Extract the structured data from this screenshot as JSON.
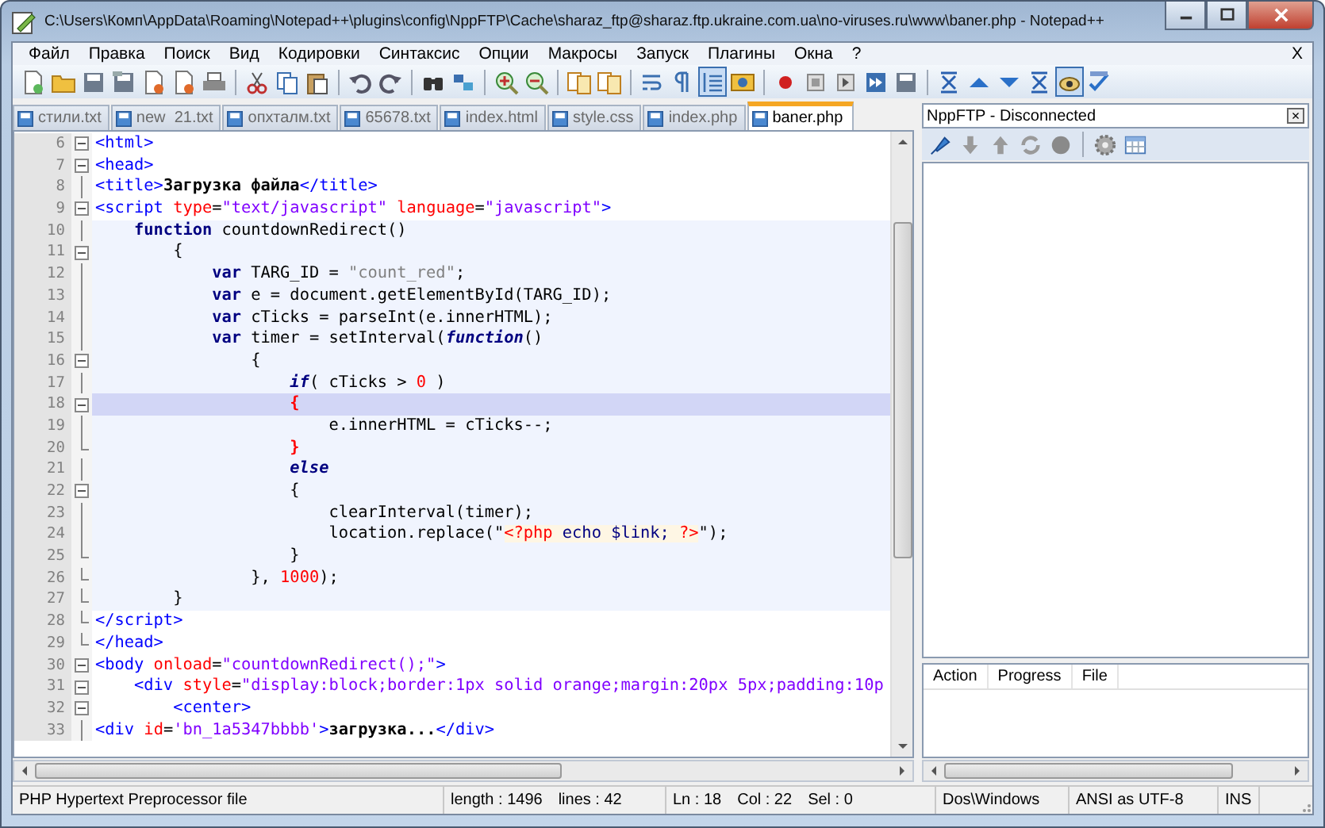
{
  "window": {
    "title": "C:\\Users\\Комп\\AppData\\Roaming\\Notepad++\\plugins\\config\\NppFTP\\Cache\\sharaz_ftp@sharaz.ftp.ukraine.com.ua\\no-viruses.ru\\www\\baner.php - Notepad++"
  },
  "menu": [
    "Файл",
    "Правка",
    "Поиск",
    "Вид",
    "Кодировки",
    "Синтаксис",
    "Опции",
    "Макросы",
    "Запуск",
    "Плагины",
    "Окна",
    "?"
  ],
  "menu_close": "X",
  "toolbar": [
    {
      "pressed": false
    },
    {
      "pressed": false
    },
    {
      "pressed": false
    },
    {
      "pressed": false
    },
    {
      "pressed": false
    },
    {
      "pressed": false
    },
    {
      "pressed": false
    },
    {
      "pressed": false
    },
    {
      "pressed": false
    },
    {
      "pressed": false
    },
    {
      "pressed": false
    },
    {
      "pressed": false
    },
    {
      "pressed": false
    },
    {
      "pressed": false
    },
    {
      "pressed": false
    },
    {
      "pressed": false
    },
    {
      "pressed": false
    },
    {
      "pressed": false
    },
    {
      "pressed": false
    },
    {
      "pressed": false
    },
    {
      "pressed": true
    },
    {
      "pressed": false
    },
    {
      "pressed": false
    },
    {
      "pressed": false
    },
    {
      "pressed": false
    },
    {
      "pressed": false
    },
    {
      "pressed": false
    },
    {
      "pressed": false
    },
    {
      "pressed": false
    },
    {
      "pressed": false
    },
    {
      "pressed": false
    },
    {
      "pressed": true
    },
    {
      "pressed": false
    }
  ],
  "tabs": [
    {
      "label": "стили.txt",
      "selected": false
    },
    {
      "label": "new  21.txt",
      "selected": false
    },
    {
      "label": "опхталм.txt",
      "selected": false
    },
    {
      "label": "65678.txt",
      "selected": false
    },
    {
      "label": "index.html",
      "selected": false
    },
    {
      "label": "style.css",
      "selected": false
    },
    {
      "label": "index.php",
      "selected": false
    },
    {
      "label": "baner.php",
      "selected": true
    }
  ],
  "editor": {
    "lines": [
      {
        "number": "6",
        "kind": "fold-start",
        "block": false,
        "current": false,
        "tokens": [
          {
            "text": "<html>",
            "kind": "tag"
          }
        ]
      },
      {
        "number": "7",
        "kind": "fold-start",
        "block": false,
        "current": false,
        "tokens": [
          {
            "text": "<head>",
            "kind": "tag"
          }
        ]
      },
      {
        "number": "8",
        "kind": "fold-body",
        "block": false,
        "current": false,
        "tokens": [
          {
            "text": "<title>",
            "kind": "tag"
          },
          {
            "text": "Загрузка файла",
            "kind": "text"
          },
          {
            "text": "</title>",
            "kind": "tag"
          }
        ]
      },
      {
        "number": "9",
        "kind": "fold-start",
        "block": false,
        "current": false,
        "tokens": [
          {
            "text": "<script",
            "kind": "tag"
          },
          {
            "text": " type",
            "kind": "attr"
          },
          {
            "text": "=",
            "kind": "code"
          },
          {
            "text": "\"text/javascript\"",
            "kind": "val"
          },
          {
            "text": " language",
            "kind": "attr"
          },
          {
            "text": "=",
            "kind": "code"
          },
          {
            "text": "\"javascript\"",
            "kind": "val"
          },
          {
            "text": ">",
            "kind": "tag"
          }
        ]
      },
      {
        "number": "10",
        "kind": "fold-body",
        "block": true,
        "current": false,
        "tokens": [
          {
            "text": "    function",
            "kind": "kw"
          },
          {
            "text": " countdownRedirect()",
            "kind": "code"
          }
        ]
      },
      {
        "number": "11",
        "kind": "fold-start",
        "block": true,
        "current": false,
        "tokens": [
          {
            "text": "        {",
            "kind": "code"
          }
        ]
      },
      {
        "number": "12",
        "kind": "fold-body",
        "block": true,
        "current": false,
        "tokens": [
          {
            "text": "            var",
            "kind": "kw"
          },
          {
            "text": " TARG_ID = ",
            "kind": "code"
          },
          {
            "text": "\"count_red\"",
            "kind": "str"
          },
          {
            "text": ";",
            "kind": "code"
          }
        ]
      },
      {
        "number": "13",
        "kind": "fold-body",
        "block": true,
        "current": false,
        "tokens": [
          {
            "text": "            var",
            "kind": "kw"
          },
          {
            "text": " e = document.getElementById(TARG_ID);",
            "kind": "code"
          }
        ]
      },
      {
        "number": "14",
        "kind": "fold-body",
        "block": true,
        "current": false,
        "tokens": [
          {
            "text": "            var",
            "kind": "kw"
          },
          {
            "text": " cTicks = parseInt(e.innerHTML);",
            "kind": "code"
          }
        ]
      },
      {
        "number": "15",
        "kind": "fold-body",
        "block": true,
        "current": false,
        "tokens": [
          {
            "text": "            var",
            "kind": "kw"
          },
          {
            "text": " timer = setInterval(",
            "kind": "code"
          },
          {
            "text": "function",
            "kind": "kwi"
          },
          {
            "text": "()",
            "kind": "code"
          }
        ]
      },
      {
        "number": "16",
        "kind": "fold-start",
        "block": true,
        "current": false,
        "tokens": [
          {
            "text": "                {",
            "kind": "code"
          }
        ]
      },
      {
        "number": "17",
        "kind": "fold-body",
        "block": true,
        "current": false,
        "tokens": [
          {
            "text": "                    if",
            "kind": "kwi"
          },
          {
            "text": "( cTicks > ",
            "kind": "code"
          },
          {
            "text": "0",
            "kind": "num"
          },
          {
            "text": " )",
            "kind": "code"
          }
        ]
      },
      {
        "number": "18",
        "kind": "fold-start",
        "block": true,
        "current": true,
        "tokens": [
          {
            "text": "                    {",
            "kind": "brace"
          }
        ]
      },
      {
        "number": "19",
        "kind": "fold-body",
        "block": true,
        "current": false,
        "tokens": [
          {
            "text": "                        e.innerHTML = cTicks--;",
            "kind": "code"
          }
        ]
      },
      {
        "number": "20",
        "kind": "fold-end",
        "block": true,
        "current": false,
        "tokens": [
          {
            "text": "                    }",
            "kind": "brace"
          }
        ]
      },
      {
        "number": "21",
        "kind": "fold-body",
        "block": true,
        "current": false,
        "tokens": [
          {
            "text": "                    else",
            "kind": "kwi"
          }
        ]
      },
      {
        "number": "22",
        "kind": "fold-start",
        "block": true,
        "current": false,
        "tokens": [
          {
            "text": "                    {",
            "kind": "code"
          }
        ]
      },
      {
        "number": "23",
        "kind": "fold-body",
        "block": true,
        "current": false,
        "tokens": [
          {
            "text": "                        clearInterval(timer);",
            "kind": "code"
          }
        ]
      },
      {
        "number": "24",
        "kind": "fold-body",
        "block": true,
        "current": false,
        "tokens": [
          {
            "text": "                        location.replace(\"",
            "kind": "code"
          },
          {
            "text": "<?php",
            "kind": "phpd"
          },
          {
            "text": " echo $link; ",
            "kind": "php"
          },
          {
            "text": "?>",
            "kind": "phpd"
          },
          {
            "text": "\");",
            "kind": "code"
          }
        ]
      },
      {
        "number": "25",
        "kind": "fold-end",
        "block": true,
        "current": false,
        "tokens": [
          {
            "text": "                    }",
            "kind": "code"
          }
        ]
      },
      {
        "number": "26",
        "kind": "fold-end",
        "block": true,
        "current": false,
        "tokens": [
          {
            "text": "                }, ",
            "kind": "code"
          },
          {
            "text": "1000",
            "kind": "num"
          },
          {
            "text": ");",
            "kind": "code"
          }
        ]
      },
      {
        "number": "27",
        "kind": "fold-end",
        "block": true,
        "current": false,
        "tokens": [
          {
            "text": "        }",
            "kind": "code"
          }
        ]
      },
      {
        "number": "28",
        "kind": "fold-end",
        "block": false,
        "current": false,
        "tokens": [
          {
            "text": "</script>",
            "kind": "tag"
          }
        ]
      },
      {
        "number": "29",
        "kind": "fold-end",
        "block": false,
        "current": false,
        "tokens": [
          {
            "text": "</head>",
            "kind": "tag"
          }
        ]
      },
      {
        "number": "30",
        "kind": "fold-start",
        "block": false,
        "current": false,
        "tokens": [
          {
            "text": "<body",
            "kind": "tag"
          },
          {
            "text": " onload",
            "kind": "attr"
          },
          {
            "text": "=",
            "kind": "code"
          },
          {
            "text": "\"countdownRedirect();\"",
            "kind": "val"
          },
          {
            "text": ">",
            "kind": "tag"
          }
        ]
      },
      {
        "number": "31",
        "kind": "fold-start",
        "block": false,
        "current": false,
        "tokens": [
          {
            "text": "    <div",
            "kind": "tag"
          },
          {
            "text": " style",
            "kind": "attr"
          },
          {
            "text": "=",
            "kind": "code"
          },
          {
            "text": "\"display:block;border:1px solid orange;margin:20px 5px;padding:10p",
            "kind": "val"
          }
        ]
      },
      {
        "number": "32",
        "kind": "fold-start",
        "block": false,
        "current": false,
        "tokens": [
          {
            "text": "        <center>",
            "kind": "tag"
          }
        ]
      },
      {
        "number": "33",
        "kind": "fold-body",
        "block": false,
        "current": false,
        "tokens": [
          {
            "text": "<div",
            "kind": "tag"
          },
          {
            "text": " id",
            "kind": "attr"
          },
          {
            "text": "=",
            "kind": "code"
          },
          {
            "text": "'bn_1a5347bbbb'",
            "kind": "val"
          },
          {
            "text": ">",
            "kind": "tag"
          },
          {
            "text": "загрузка...",
            "kind": "text"
          },
          {
            "text": "</div>",
            "kind": "tag"
          }
        ]
      }
    ]
  },
  "ftp_panel": {
    "title": "NppFTP - Disconnected",
    "close": "×",
    "columns": [
      "Action",
      "Progress",
      "File"
    ]
  },
  "status_bar": [
    [
      "PHP Hypertext Preprocessor file"
    ],
    [
      "length : 1496",
      "lines : 42"
    ],
    [
      "Ln : 18",
      "Col : 22",
      "Sel : 0"
    ],
    [
      "Dos\\Windows"
    ],
    [
      "ANSI as UTF-8"
    ],
    [
      "INS"
    ]
  ]
}
